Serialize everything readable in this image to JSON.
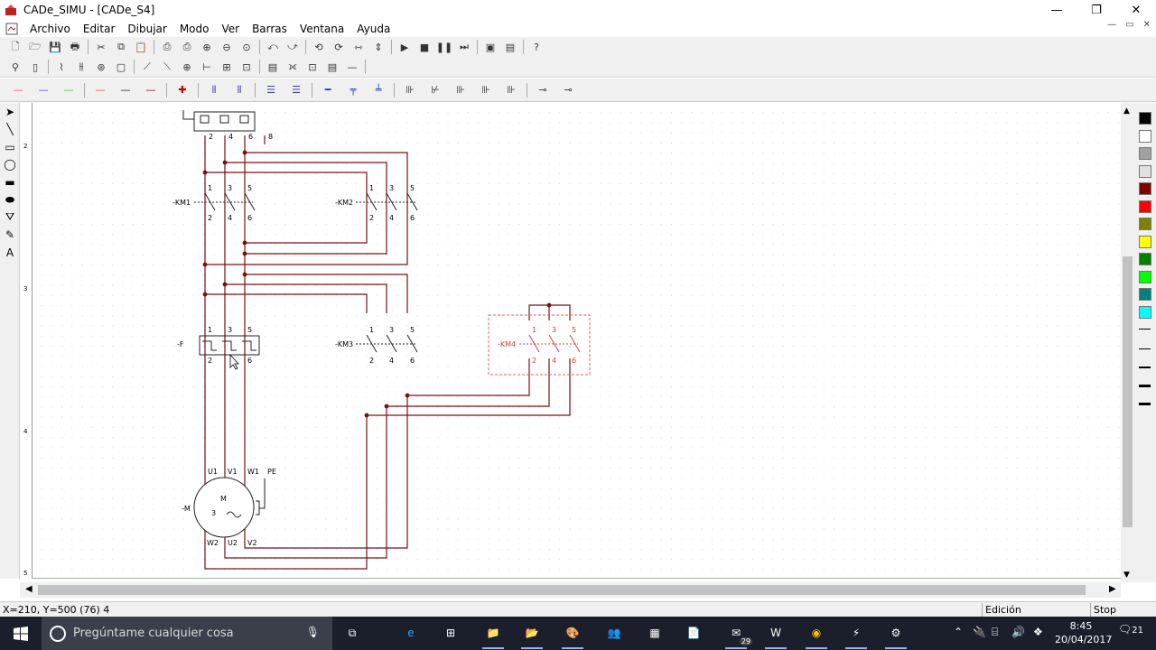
{
  "window": {
    "title": "CADe_SIMU - [CADe_S4]",
    "controls": {
      "minimize": "—",
      "maximize": "❐",
      "close": "✕"
    }
  },
  "menu": {
    "items": [
      "Archivo",
      "Editar",
      "Dibujar",
      "Modo",
      "Ver",
      "Barras",
      "Ventana",
      "Ayuda"
    ],
    "mdi_controls": {
      "minimize": "—",
      "restore": "▭",
      "close": "✕"
    }
  },
  "toolbar1": {
    "icons": [
      "new-file-icon",
      "open-folder-icon",
      "save-icon",
      "print-icon",
      "cut-icon",
      "copy-icon",
      "paste-icon",
      "print-preview-icon",
      "print-setup-icon",
      "zoom-in-icon",
      "zoom-out-icon",
      "zoom-fit-icon",
      "undo-icon",
      "redo-icon",
      "rotate-left-icon",
      "rotate-right-icon",
      "mirror-h-icon",
      "mirror-v-icon",
      "play-icon",
      "stop-icon",
      "pause-icon",
      "step-icon",
      "view-sheet-icon",
      "view-component-icon",
      "help-icon"
    ],
    "glyphs": [
      "🗋",
      "🗁",
      "💾",
      "🖶",
      "✂",
      "⧉",
      "📋",
      "⎙",
      "⎙",
      "⊕",
      "⊖",
      "⊙",
      "⤺",
      "⤻",
      "⟲",
      "⟳",
      "⇿",
      "⇕",
      "▶",
      "■",
      "❚❚",
      "⏭",
      "▣",
      "▤",
      "?"
    ]
  },
  "toolbar2": {
    "icons": [
      "probe-icon",
      "fuse-icon",
      "switch-icon",
      "multi-switch-icon",
      "motor-icon",
      "relay-icon",
      "contact-no-icon",
      "contact-nc-icon",
      "node-icon",
      "terminal-icon",
      "connector-icon",
      "coil-icon",
      "breaker-icon",
      "timer-icon",
      "meter-icon",
      "counter-icon",
      "line-icon"
    ],
    "glyphs": [
      "⚲",
      "▯",
      "⌇",
      "⫵",
      "⊛",
      "▢",
      "⟋",
      "⟍",
      "⊕",
      "⊢",
      "⊞",
      "⊡",
      "▤",
      "⟗",
      "⊡",
      "▤",
      "—"
    ]
  },
  "toolbar3": {
    "icons": [
      "wire-red-icon",
      "wire-blue-icon",
      "wire-green-icon",
      "wire-red2-icon",
      "wire-black-icon",
      "wire-brown-icon",
      "junction-icon",
      "wire3-v-icon",
      "wire4-v-icon",
      "wire3-h-icon",
      "wire4-h-icon",
      "bus-icon",
      "bus-cross-icon",
      "bus-branch-icon",
      "plug-icon",
      "plug2-icon",
      "plug3-icon",
      "plug4-icon",
      "plug5-icon",
      "end-icon",
      "end2-icon"
    ],
    "glyphs": [
      "—",
      "—",
      "—",
      "—",
      "—",
      "—",
      "✚",
      "⦀",
      "⦀",
      "☰",
      "☰",
      "━",
      "╤",
      "╧",
      "⊪",
      "⊬",
      "⊪",
      "⊪",
      "⊪",
      "⊸",
      "⊸"
    ],
    "colors": [
      "#e05050",
      "#5050e0",
      "#50c050",
      "#e05050",
      "#202020",
      "#7a1010",
      "#c00000",
      "#4040a0",
      "#4040a0",
      "#4040a0",
      "#4040a0",
      "#1f3fbf",
      "#1f3fbf",
      "#1f3fbf",
      "#333",
      "#333",
      "#333",
      "#333",
      "#333",
      "#333",
      "#333"
    ]
  },
  "left_tools": {
    "icons": [
      "pointer-icon",
      "line-tool-icon",
      "rect-tool-icon",
      "ellipse-tool-icon",
      "filled-rect-icon",
      "filled-ellipse-icon",
      "fill-icon",
      "pen-icon",
      "text-tool-icon"
    ],
    "glyphs": [
      "➤",
      "╲",
      "▭",
      "◯",
      "▬",
      "⬬",
      "⛛",
      "✎",
      "A"
    ]
  },
  "ruler": {
    "labels": [
      "2",
      "3",
      "4",
      "5"
    ]
  },
  "schematic": {
    "labels": {
      "km1": "-KM1",
      "km2": "-KM2",
      "km3": "-KM3",
      "km4": "-KM4",
      "f": "-F",
      "m": "-M",
      "motor_m": "M",
      "motor_3": "3",
      "motor_tilde": "~",
      "u1": "U1",
      "v1": "V1",
      "w1": "W1",
      "pe": "PE",
      "w2": "W2",
      "u2": "U2",
      "v2": "V2",
      "t1": "1",
      "t2": "2",
      "t3": "3",
      "t4": "4",
      "t5": "5",
      "t6": "6",
      "t8": "8"
    }
  },
  "palette": {
    "colors": [
      "#000000",
      "#ffffff",
      "#a0a0a0",
      "#e0e0e0",
      "#800000",
      "#ff0000",
      "#808000",
      "#ffff00",
      "#008000",
      "#00ff00",
      "#008080",
      "#00ffff"
    ]
  },
  "status": {
    "coords": "X=210, Y=500 (76) 4",
    "mode": "Edición",
    "sim_state": "Stop"
  },
  "taskbar": {
    "search_placeholder": "Pregúntame cualquier cosa",
    "apps": [
      "task-view-icon",
      "edge-icon",
      "store-icon",
      "file-explorer-icon",
      "explorer-icon",
      "paint-icon",
      "people-icon",
      "calculator-icon",
      "files-icon",
      "mail-icon",
      "word-icon",
      "chrome-icon",
      "cadesimu-icon",
      "tool-icon"
    ],
    "mail_badge": "29",
    "time": "8:45",
    "date": "20/04/2017",
    "notification_count": "21"
  }
}
